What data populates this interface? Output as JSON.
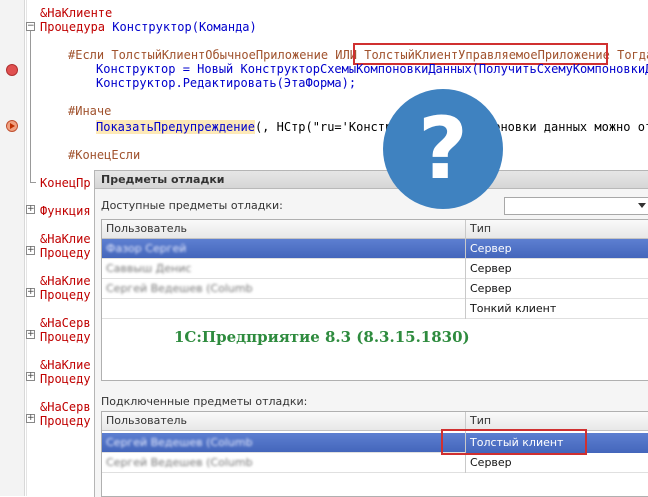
{
  "code": {
    "l1": "&НаКлиенте",
    "l2_kw": "Процедура",
    "l2_id": "Конструктор(Команда)",
    "l3_pp": "#Если ТолстыйКлиентОбычноеПриложение ИЛИ",
    "l3_box": "ТолстыйКлиентУправляемоеПриложение",
    "l3_tail": "Тогда",
    "l4": "Конструктор = Новый КонструкторСхемыКомпоновкиДанных(ПолучитьСхемуКомпоновкиДан",
    "l5": "Конструктор.Редактировать(ЭтаФорма);",
    "l6_pp": "#Иначе",
    "l7_fn": "ПоказатьПредупреждение",
    "l7_rest": "(, НСтр(\"ru='Конструкт",
    "l7_tail": "поновки данных можно от",
    "l8_pp": "#КонецЕсли",
    "l9": "КонецПр",
    "l10": "Функция",
    "l11": "&НаКлие",
    "l12": "Процеду",
    "l13": "&НаКлие",
    "l14": "Процеду",
    "l15": "&НаСерв",
    "l16": "Процеду",
    "l17": "&НаКлие",
    "l18": "Процеду",
    "l19": "&НаСерв",
    "l20": "Процеду"
  },
  "overlay": {
    "qmark": "?"
  },
  "dialog": {
    "title": "Предметы отладки",
    "available_label": "Доступные предметы отладки:",
    "connected_label": "Подключенные предметы отладки:",
    "col_user": "Пользователь",
    "col_type": "Тип",
    "available_rows": [
      {
        "user": "Фазор Сергей",
        "type": "Сервер"
      },
      {
        "user": "Саввыш Денис",
        "type": "Сервер"
      },
      {
        "user": "Сергей Ведешев (Columbus)",
        "type": "Сервер"
      },
      {
        "user": "",
        "type": "Тонкий клиент"
      }
    ],
    "connected_rows": [
      {
        "user": "Сергей Ведешев (Columbus)",
        "type": "Толстый клиент"
      },
      {
        "user": "Сергей Ведешев (Columbus)",
        "type": "Сервер"
      }
    ],
    "version": "1С:Предприятие 8.3 (8.3.15.1830)"
  },
  "colors": {
    "highlight_box": "#d03030",
    "selection": "#4f70c6",
    "version_text": "#2e8b3e",
    "qmark_circle": "#3f82c0"
  }
}
